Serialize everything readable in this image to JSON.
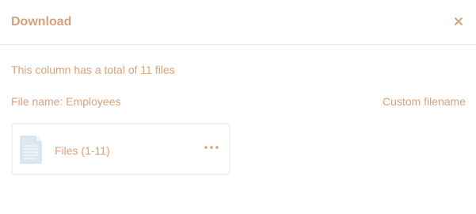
{
  "dialog": {
    "title": "Download",
    "close_icon": "close-icon",
    "summary": "This column has a total of 11 files",
    "filename_label": "File name: Employees",
    "custom_filename_link": "Custom filename",
    "file_card": {
      "label": "Files (1-11)",
      "icon": "document-icon",
      "more_icon": "more-dots-icon"
    }
  },
  "colors": {
    "accent": "#d9a27c",
    "divider": "#e8e8e8",
    "card_border": "#eef4f8",
    "doc_icon_fill": "#dbe8f2"
  }
}
